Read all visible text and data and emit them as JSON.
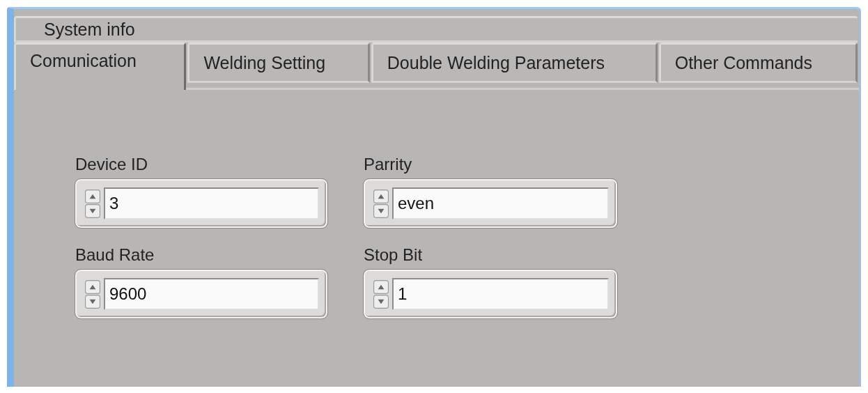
{
  "tab_rows": [
    [
      {
        "label": "System info",
        "selected": false
      }
    ],
    [
      {
        "label": "Comunication",
        "selected": true
      },
      {
        "label": "Welding Setting",
        "selected": false
      },
      {
        "label": "Double Welding Parameters",
        "selected": false
      },
      {
        "label": "Other Commands",
        "selected": false
      }
    ]
  ],
  "controls": [
    {
      "label": "Device ID",
      "value": "3"
    },
    {
      "label": "Parrity",
      "value": "even"
    },
    {
      "label": "Baud Rate",
      "value": "9600"
    },
    {
      "label": "Stop Bit",
      "value": "1"
    }
  ]
}
